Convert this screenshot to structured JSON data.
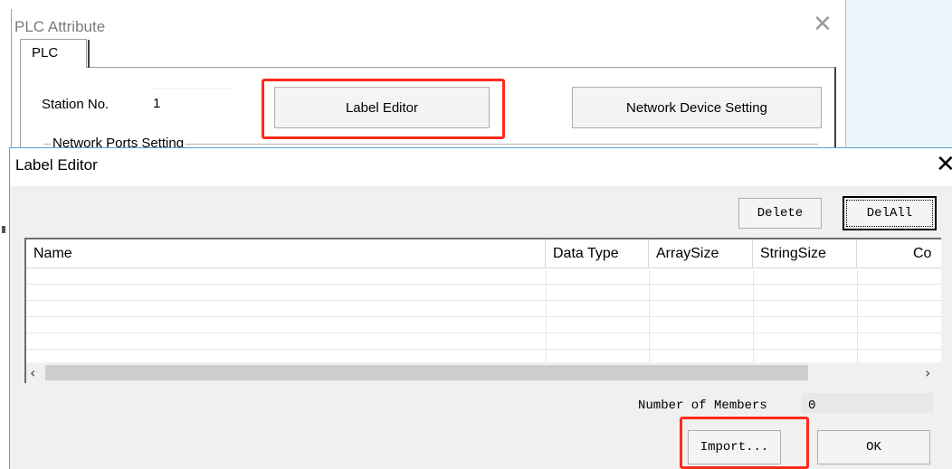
{
  "plc_window": {
    "title": "PLC Attribute",
    "close_glyph": "✕",
    "tab_label": "PLC",
    "station_label": "Station No.",
    "station_value": "1",
    "label_editor_button": "Label Editor",
    "network_device_button": "Network Device Setting",
    "ports_group_label": "Network Ports Setting"
  },
  "label_editor": {
    "title": "Label Editor",
    "close_glyph": "✕",
    "delete_button": "Delete",
    "delall_button": "DelAll",
    "columns": [
      "Name",
      "Data Type",
      "ArraySize",
      "StringSize",
      "Co"
    ],
    "rows": [],
    "scroll_left": "‹",
    "scroll_right": "›",
    "members_label": "Number of Members",
    "members_count": "0",
    "import_button": "Import...",
    "ok_button": "OK"
  },
  "colors": {
    "highlight": "#ff2a1a",
    "dialog_border": "#5aa0d8",
    "right_panel": "#eaf6fb"
  }
}
